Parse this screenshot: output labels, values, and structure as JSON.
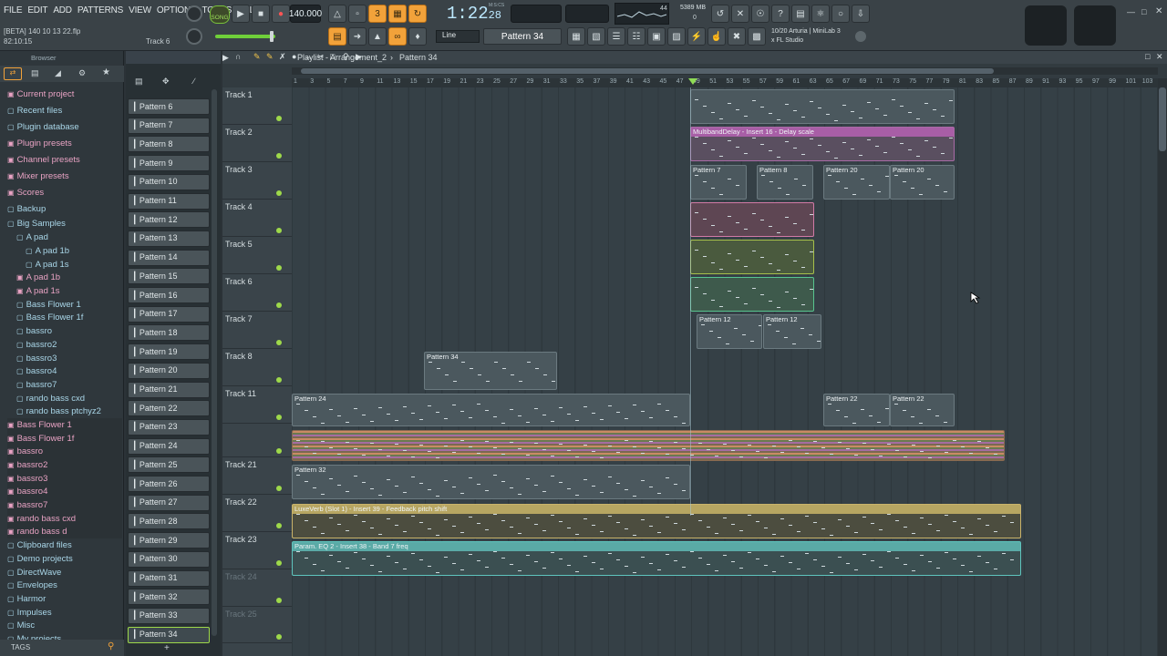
{
  "menu": [
    "FILE",
    "EDIT",
    "ADD",
    "PATTERNS",
    "VIEW",
    "OPTIONS",
    "TOOLS",
    "HELP"
  ],
  "hint_line1": "[BETA] 140 10 13 22.flp",
  "hint_line2": "82:10:15",
  "hint_track": "Track 6",
  "song_mode": "SONG",
  "tempo": "140.000",
  "time": "1:22",
  "time_small": "28",
  "time_unit": "M:S:CS",
  "cpu": "44",
  "memory": "5389 MB",
  "memory_sub": "0",
  "snap": "Line",
  "pattern_selector": "Pattern 34",
  "device_line1": "10/20  Arturia | MiniLab 3",
  "device_line2": "x FL Studio",
  "browser": {
    "title": "Browser",
    "tags_label": "TAGS",
    "items": [
      {
        "label": "Current project",
        "kind": "pink"
      },
      {
        "label": "Recent files",
        "kind": "fold"
      },
      {
        "label": "Plugin database",
        "kind": "fold"
      },
      {
        "label": "Plugin presets",
        "kind": "pink"
      },
      {
        "label": "Channel presets",
        "kind": "pink"
      },
      {
        "label": "Mixer presets",
        "kind": "pink"
      },
      {
        "label": "Scores",
        "kind": "pink"
      },
      {
        "label": "Backup",
        "kind": "fold"
      },
      {
        "label": "Big Samples",
        "kind": "fold"
      },
      {
        "label": "A pad",
        "kind": "fold"
      },
      {
        "label": "A pad 1b",
        "kind": "fold"
      },
      {
        "label": "A pad 1s",
        "kind": "fold"
      },
      {
        "label": "A pad 1b",
        "kind": "pink"
      },
      {
        "label": "A pad 1s",
        "kind": "pink"
      },
      {
        "label": "Bass Flower 1",
        "kind": "fold"
      },
      {
        "label": "Bass Flower 1f",
        "kind": "fold"
      },
      {
        "label": "bassro",
        "kind": "fold"
      },
      {
        "label": "bassro2",
        "kind": "fold"
      },
      {
        "label": "bassro3",
        "kind": "fold"
      },
      {
        "label": "bassro4",
        "kind": "fold"
      },
      {
        "label": "bassro7",
        "kind": "fold"
      },
      {
        "label": "rando bass cxd",
        "kind": "fold"
      },
      {
        "label": "rando bass ptchyz2",
        "kind": "fold"
      },
      {
        "label": "Bass Flower 1",
        "kind": "pink"
      },
      {
        "label": "Bass Flower 1f",
        "kind": "pink"
      },
      {
        "label": "bassro",
        "kind": "pink"
      },
      {
        "label": "bassro2",
        "kind": "pink"
      },
      {
        "label": "bassro3",
        "kind": "pink"
      },
      {
        "label": "bassro4",
        "kind": "pink"
      },
      {
        "label": "bassro7",
        "kind": "pink"
      },
      {
        "label": "rando bass cxd",
        "kind": "pink"
      },
      {
        "label": "rando bass d",
        "kind": "pink"
      },
      {
        "label": "Clipboard files",
        "kind": "fold"
      },
      {
        "label": "Demo projects",
        "kind": "fold"
      },
      {
        "label": "DirectWave",
        "kind": "fold"
      },
      {
        "label": "Envelopes",
        "kind": "fold"
      },
      {
        "label": "Harmor",
        "kind": "fold"
      },
      {
        "label": "Impulses",
        "kind": "fold"
      },
      {
        "label": "Misc",
        "kind": "fold"
      },
      {
        "label": "My projects",
        "kind": "fold"
      }
    ]
  },
  "patterns": [
    "Pattern 6",
    "Pattern 7",
    "Pattern 8",
    "Pattern 9",
    "Pattern 10",
    "Pattern 11",
    "Pattern 12",
    "Pattern 13",
    "Pattern 14",
    "Pattern 15",
    "Pattern 16",
    "Pattern 17",
    "Pattern 18",
    "Pattern 19",
    "Pattern 20",
    "Pattern 21",
    "Pattern 22",
    "Pattern 23",
    "Pattern 24",
    "Pattern 25",
    "Pattern 26",
    "Pattern 27",
    "Pattern 28",
    "Pattern 29",
    "Pattern 30",
    "Pattern 31",
    "Pattern 32",
    "Pattern 33",
    "Pattern 34"
  ],
  "playlist": {
    "title": "Playlist - Arrangement_2",
    "current_pattern": "Pattern 34",
    "ruler": [
      "1",
      "3",
      "5",
      "7",
      "9",
      "11",
      "13",
      "15",
      "17",
      "19",
      "21",
      "23",
      "25",
      "27",
      "29",
      "31",
      "33",
      "35",
      "37",
      "39",
      "41",
      "43",
      "45",
      "47",
      "49",
      "51",
      "53",
      "55",
      "57",
      "59",
      "61",
      "63",
      "65",
      "67",
      "69",
      "71",
      "73",
      "75",
      "77",
      "79",
      "81",
      "83",
      "85",
      "87",
      "89",
      "91",
      "93",
      "95",
      "97",
      "99",
      "101",
      "103"
    ],
    "tracks": [
      {
        "name": "Track 1"
      },
      {
        "name": "Track 2"
      },
      {
        "name": "Track 3"
      },
      {
        "name": "Track 4"
      },
      {
        "name": "Track 5"
      },
      {
        "name": "Track 6"
      },
      {
        "name": "Track 7"
      },
      {
        "name": "Track 8"
      },
      {
        "name": "Track 11"
      },
      {
        "name": ""
      },
      {
        "name": "Track 21"
      },
      {
        "name": "Track 22"
      },
      {
        "name": "Track 23"
      },
      {
        "name": "Track 24"
      },
      {
        "name": "Track 25"
      }
    ],
    "clips": {
      "multiband": "MultibandDelay - Insert 16 - Delay scale",
      "p7": "Pattern 7",
      "p8": "Pattern 8",
      "p20a": "Pattern 20",
      "p20b": "Pattern 20",
      "p12a": "Pattern 12",
      "p12b": "Pattern 12",
      "p34": "Pattern 34",
      "p24": "Pattern 24",
      "p22a": "Pattern 22",
      "p22b": "Pattern 22",
      "p32": "Pattern 32",
      "luxe": "LuxeVerb (Slot 1) - Insert 39 - Feedback pitch shift",
      "eq": "Param. EQ 2 - Insert 38 - Band 7 freq"
    }
  }
}
